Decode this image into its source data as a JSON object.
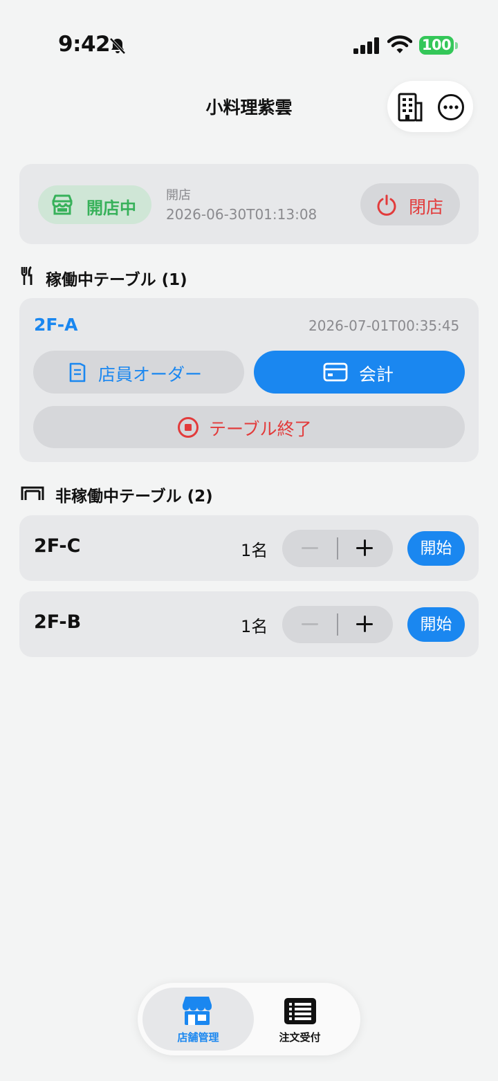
{
  "status_bar": {
    "time": "9:42",
    "battery": "100"
  },
  "header": {
    "title": "小料理紫雲"
  },
  "store_status": {
    "badge": "開店中",
    "caption": "開店",
    "timestamp": "2026-06-30T01:13:08",
    "close_button": "閉店"
  },
  "active_section": {
    "title": "稼働中テーブル (1)",
    "tables": [
      {
        "name": "2F-A",
        "time": "2026-07-01T00:35:45",
        "staff_order_label": "店員オーダー",
        "checkout_label": "会計",
        "end_label": "テーブル終了"
      }
    ]
  },
  "idle_section": {
    "title": "非稼働中テーブル (2)",
    "tables": [
      {
        "name": "2F-C",
        "guests": "1名",
        "start_label": "開始"
      },
      {
        "name": "2F-B",
        "guests": "1名",
        "start_label": "開始"
      }
    ]
  },
  "tabs": [
    {
      "label": "店舗管理",
      "icon": "storefront-icon",
      "active": true
    },
    {
      "label": "注文受付",
      "icon": "order-list-icon",
      "active": false
    }
  ],
  "colors": {
    "accent": "#1a87f0",
    "open": "#37b15a",
    "danger": "#e23b3b",
    "card": "#e7e8ea",
    "background": "#f3f4f4"
  }
}
